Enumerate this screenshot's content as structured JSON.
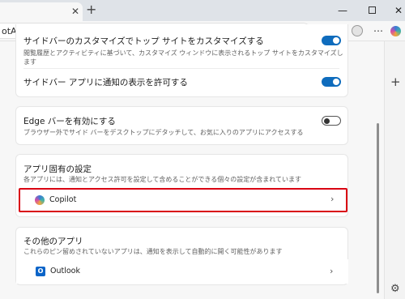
{
  "browser": {
    "tab_close_glyph": "✕",
    "new_tab_glyph": "+",
    "address_text": "otAndSidebar",
    "window": {
      "minimize": "—",
      "close": "✕"
    },
    "toolbar": {
      "fav": "☆",
      "collections": "⧉",
      "more": "⋯"
    }
  },
  "sidebar_strip": {
    "add_glyph": "+",
    "settings_glyph": "⚙"
  },
  "settings": {
    "card1": {
      "item1_title": "サイドバーのカスタマイズでトップ サイトをカスタマイズする",
      "item1_desc_line1": "閲覧履歴とアクティビティに基づいて、カスタマイズ ウィンドウに表示されるトップ サイトをカスタマイズし",
      "item1_desc_line2": "ます",
      "item1_toggle": true,
      "item2_title": "サイドバー アプリに通知の表示を許可する",
      "item2_toggle": true
    },
    "card2": {
      "title": "Edge バーを有効にする",
      "desc": "ブラウザー外でサイド バーをデスクトップにデタッチして、お気に入りのアプリにアクセスする",
      "toggle": false
    },
    "card3": {
      "title": "アプリ固有の設定",
      "desc": "各アプリには、通知とアクセス許可を設定して含めることができる個々の設定が含まれています",
      "app_name": "Copilot",
      "chevron": "›"
    },
    "card4": {
      "title": "その他のアプリ",
      "desc": "これらのピン留めされていないアプリは、通知を表示して自動的に開く可能性があります",
      "app_name": "Outlook",
      "app_icon_letter": "O",
      "chevron": "›"
    }
  },
  "colors": {
    "accent": "#0f6cbd",
    "highlight": "#d90012"
  }
}
